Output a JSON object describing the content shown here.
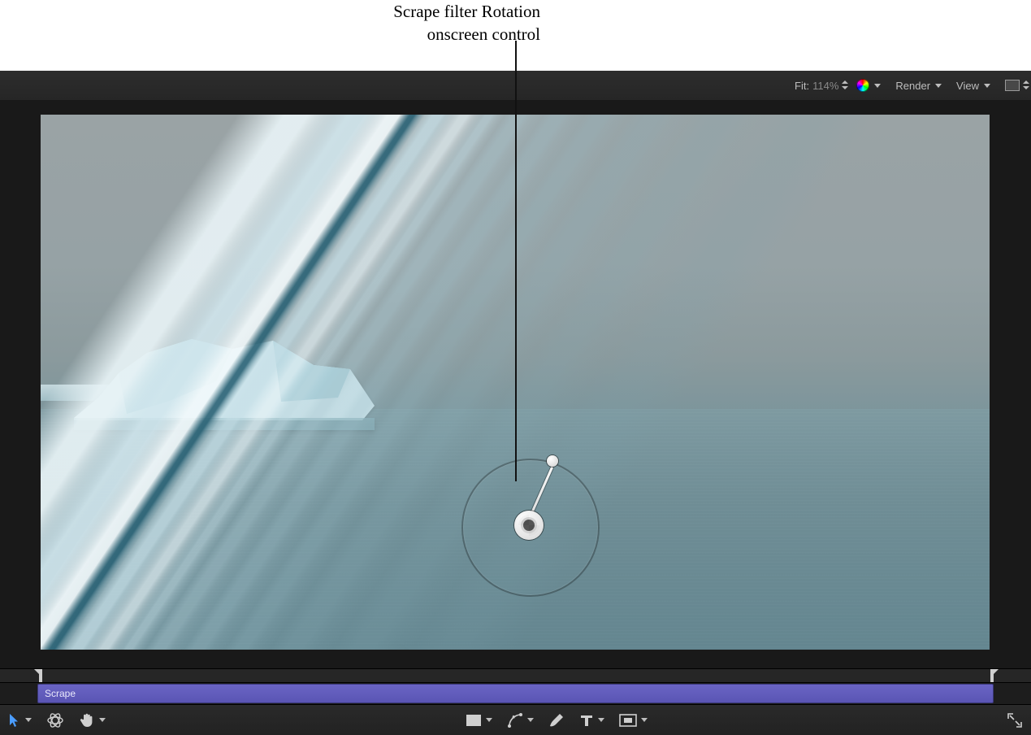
{
  "callout": {
    "line1": "Scrape filter Rotation",
    "line2": "onscreen control"
  },
  "topbar": {
    "fit_label": "Fit:",
    "fit_value": "114%",
    "render_label": "Render",
    "view_label": "View"
  },
  "timeline": {
    "clip_name": "Scrape"
  },
  "tools": {
    "select": "Select",
    "orbit": "3D Orbit",
    "pan": "Pan",
    "rect": "Rectangle",
    "pen": "Pen",
    "brush": "Brush",
    "text": "Text",
    "mask": "Mask",
    "fullscreen": "Fullscreen"
  },
  "icons": {
    "color_channels": "color-channels",
    "background_swatch": "background-swatch"
  }
}
